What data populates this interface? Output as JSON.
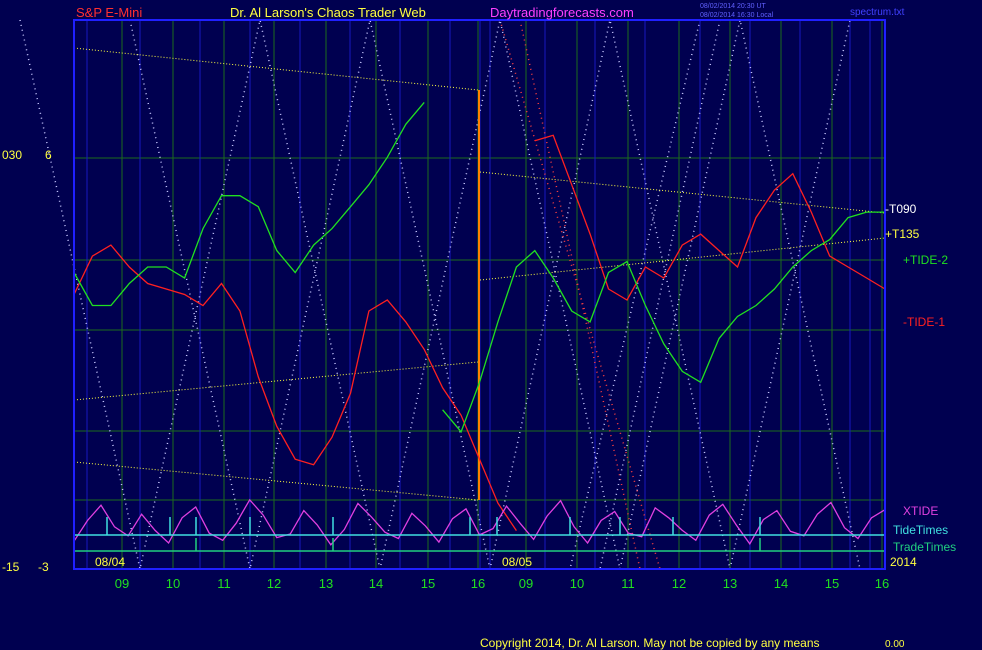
{
  "header": {
    "symbol": "S&P E-Mini",
    "site_title": "Dr. Al Larson's Chaos Trader Web",
    "site_url": "Daytradingforecasts.com",
    "stamp_1": "08/02/2014 20:30 UT",
    "stamp_2": "08/02/2014 16:30 Local",
    "file_name": "spectrum.txt"
  },
  "footer": {
    "copyright": "Copyright 2014, Dr. Al Larson. May not be copied by any means",
    "corner_value": "0.00"
  },
  "colors": {
    "background": "#000050",
    "frame": "#0000ff",
    "grid": "#1c6b1c",
    "tide1": "#ff2020",
    "tide2": "#20e020",
    "xtide": "#e040e0",
    "tide_times": "#40e0e0",
    "trade_times": "#20d080",
    "yellow": "#ffff40",
    "white_dots": "#c8c8ff",
    "red_dots": "#ff4040"
  },
  "chart_data": {
    "type": "line",
    "left_scale": {
      "col1_labels": [
        "030",
        "-15"
      ],
      "col2_labels": [
        "6",
        "-3"
      ]
    },
    "date_labels": [
      "08/04",
      "08/05"
    ],
    "year_label": "2014",
    "x_ticks": [
      "09",
      "10",
      "11",
      "12",
      "13",
      "14",
      "15",
      "16",
      "09",
      "10",
      "11",
      "12",
      "13",
      "14",
      "15",
      "16"
    ],
    "day_split_index": 16,
    "series": [
      {
        "name": "-TIDE-1",
        "label": "-TIDE-1",
        "color": "#ff2020",
        "values": [
          0.5,
          0.57,
          0.59,
          0.55,
          0.52,
          0.51,
          0.5,
          0.48,
          0.52,
          0.47,
          0.35,
          0.26,
          0.2,
          0.19,
          0.24,
          0.32,
          0.47,
          0.49,
          0.45,
          0.4,
          0.33,
          0.28,
          0.2,
          0.12,
          0.07,
          0.78,
          0.79,
          0.7,
          0.61,
          0.51,
          0.49,
          0.55,
          0.53,
          0.59,
          0.61,
          0.58,
          0.55,
          0.64,
          0.69,
          0.72,
          0.65,
          0.57,
          0.55,
          0.53,
          0.51
        ]
      },
      {
        "name": "+TIDE-2",
        "label": "+TIDE-2",
        "color": "#20e020",
        "values": [
          0.54,
          0.48,
          0.48,
          0.52,
          0.55,
          0.55,
          0.53,
          0.62,
          0.68,
          0.68,
          0.66,
          0.58,
          0.54,
          0.59,
          0.62,
          0.66,
          0.7,
          0.75,
          0.81,
          0.85,
          0.29,
          0.25,
          0.34,
          0.45,
          0.55,
          0.58,
          0.53,
          0.47,
          0.45,
          0.54,
          0.56,
          0.48,
          0.41,
          0.36,
          0.34,
          0.42,
          0.46,
          0.48,
          0.51,
          0.55,
          0.58,
          0.6,
          0.64,
          0.65,
          0.65
        ]
      },
      {
        "name": "XTIDE",
        "label": "XTIDE",
        "color": "#e040e0",
        "values": [
          0.32,
          0.55,
          0.72,
          0.48,
          0.38,
          0.62,
          0.44,
          0.3,
          0.58,
          0.7,
          0.41,
          0.33,
          0.52,
          0.78,
          0.61,
          0.36,
          0.4,
          0.66,
          0.5,
          0.28,
          0.45,
          0.74,
          0.59,
          0.42,
          0.35,
          0.63,
          0.49,
          0.31,
          0.57,
          0.68,
          0.39,
          0.46,
          0.71,
          0.52,
          0.34,
          0.6,
          0.77,
          0.48,
          0.3,
          0.55,
          0.65,
          0.41,
          0.37,
          0.69,
          0.58,
          0.44,
          0.33,
          0.61,
          0.73,
          0.5,
          0.29,
          0.56,
          0.66,
          0.43,
          0.38,
          0.62,
          0.75,
          0.47,
          0.35,
          0.58,
          0.67
        ]
      }
    ],
    "right_labels": [
      {
        "text": "-T090",
        "color": "#ffffff"
      },
      {
        "text": "+T135",
        "color": "#ffff40"
      },
      {
        "text": "+TIDE-2",
        "color": "#20e020"
      },
      {
        "text": "-TIDE-1",
        "color": "#ff2020"
      },
      {
        "text": "XTIDE",
        "color": "#e040e0"
      },
      {
        "text": "TideTimes",
        "color": "#40e0e0"
      },
      {
        "text": "TradeTimes",
        "color": "#20d080"
      }
    ],
    "grid": true
  }
}
